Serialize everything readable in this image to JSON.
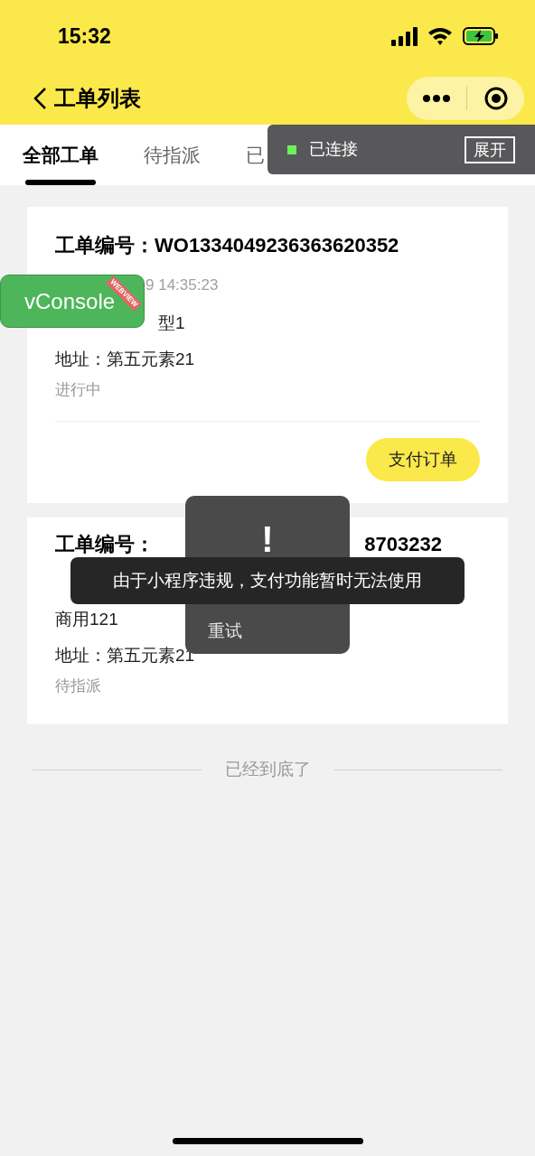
{
  "status_bar": {
    "time": "15:32"
  },
  "nav": {
    "title": "工单列表"
  },
  "tabs": [
    {
      "label": "全部工单",
      "selected": true
    },
    {
      "label": "待指派",
      "selected": false
    },
    {
      "label": "已",
      "selected": false
    }
  ],
  "orders": [
    {
      "title": [
        "工单编号：WO1334049236363620352"
      ],
      "time": "9 14:35:23",
      "type": "型1",
      "address": "地址：第五元素21",
      "status": "进行中",
      "action": "支付订单"
    },
    {
      "title": [
        "工单编号：",
        "8703232"
      ],
      "type": "商用121",
      "address": "地址：第五元素21",
      "status": "待指派"
    }
  ],
  "end_text": "已经到底了",
  "vconsole": {
    "label": "vConsole",
    "ribbon": "WEBVIEW",
    "status": "已连接",
    "expand": "展开"
  },
  "error_toast": {
    "icon": "!",
    "message": "重试"
  },
  "notice_toast": {
    "message": "由于小程序违规，支付功能暂时无法使用"
  }
}
